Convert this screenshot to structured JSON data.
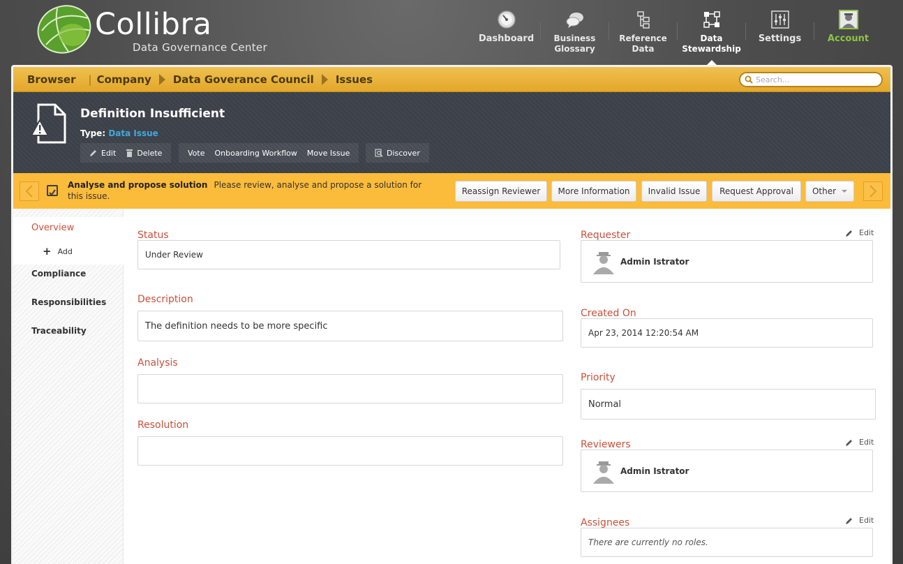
{
  "logo": {
    "name": "Collibra",
    "subtitle": "Data Governance Center"
  },
  "nav": [
    {
      "label": "Dashboard",
      "icon": "dashboard-gauge-icon"
    },
    {
      "label_line1": "Business",
      "label_line2": "Glossary",
      "icon": "speech-bubbles-icon"
    },
    {
      "label_line1": "Reference",
      "label_line2": "Data",
      "icon": "reference-tree-icon"
    },
    {
      "label_line1": "Data",
      "label_line2": "Stewardship",
      "icon": "stewardship-network-icon",
      "active": true
    },
    {
      "label": "Settings",
      "icon": "sliders-icon"
    },
    {
      "label": "Account",
      "icon": "user-avatar-icon"
    }
  ],
  "breadcrumb": {
    "items": [
      "Browser",
      "Company",
      "Data Goverance Council",
      "Issues"
    ]
  },
  "search": {
    "placeholder": "Search..."
  },
  "asset": {
    "title": "Definition Insufficient",
    "type_label": "Type:",
    "type_value": "Data Issue",
    "actions": {
      "edit": "Edit",
      "delete": "Delete",
      "vote": "Vote",
      "onboarding": "Onboarding Workflow",
      "move": "Move Issue",
      "discover": "Discover"
    }
  },
  "task": {
    "title": "Analyse and propose solution",
    "description": "Please review, analyse and propose a solution for this issue.",
    "buttons": {
      "reassign": "Reassign Reviewer",
      "more": "More Information",
      "invalid": "Invalid Issue",
      "approval": "Request Approval",
      "other": "Other"
    }
  },
  "sidebar": {
    "overview": "Overview",
    "add": "Add",
    "compliance": "Compliance",
    "responsibilities": "Responsibilities",
    "traceability": "Traceability"
  },
  "fields": {
    "status": {
      "label": "Status",
      "value": "Under Review"
    },
    "description": {
      "label": "Description",
      "value": "The definition needs to be more specific"
    },
    "analysis": {
      "label": "Analysis",
      "value": ""
    },
    "resolution": {
      "label": "Resolution",
      "value": ""
    },
    "requester": {
      "label": "Requester",
      "value": "Admin Istrator",
      "edit": "Edit"
    },
    "created_on": {
      "label": "Created On",
      "value": "Apr 23, 2014 12:20:54 AM"
    },
    "priority": {
      "label": "Priority",
      "value": "Normal"
    },
    "reviewers": {
      "label": "Reviewers",
      "value": "Admin Istrator",
      "edit": "Edit"
    },
    "assignees": {
      "label": "Assignees",
      "value": "There are currently no roles.",
      "edit": "Edit"
    }
  },
  "colors": {
    "accent_orange": "#fbbb3b",
    "breadcrumb_gold": "#e3a72a",
    "label_red": "#c9503a",
    "link_blue": "#3fa9e0",
    "dark_header": "#3b4049",
    "account_green": "#8dc63f"
  }
}
